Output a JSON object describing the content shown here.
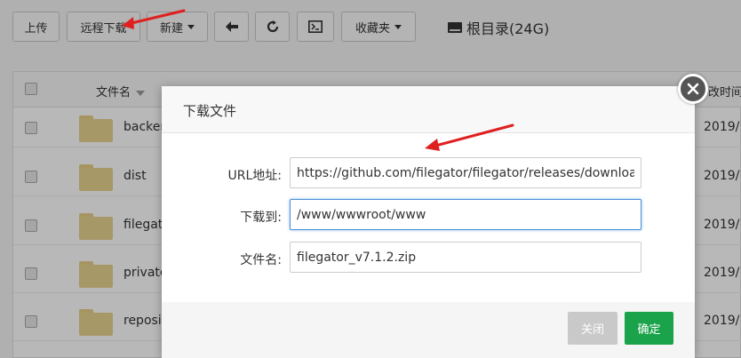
{
  "toolbar": {
    "upload": "上传",
    "remote_download": "远程下载",
    "new": "新建",
    "favorites": "收藏夹",
    "root": "根目录(24G)"
  },
  "table": {
    "header_name": "文件名",
    "header_time": "改时间",
    "rows": [
      {
        "name": "backer",
        "date": "2019/1"
      },
      {
        "name": "dist",
        "date": "2019/1"
      },
      {
        "name": "filegat",
        "date": "2019/1"
      },
      {
        "name": "private",
        "date": "2019/1"
      },
      {
        "name": "reposi",
        "date": "2019/1"
      }
    ]
  },
  "dialog": {
    "title": "下载文件",
    "url_label": "URL地址:",
    "url_value": "https://github.com/filegator/filegator/releases/download",
    "dest_label": "下载到:",
    "dest_value": "/www/wwwroot/www",
    "filename_label": "文件名:",
    "filename_value": "filegator_v7.1.2.zip",
    "close_label": "关闭",
    "confirm_label": "确定"
  },
  "colors": {
    "confirm": "#1aa34a",
    "close": "#c9c9c9",
    "annotation_arrow": "#e02020"
  }
}
